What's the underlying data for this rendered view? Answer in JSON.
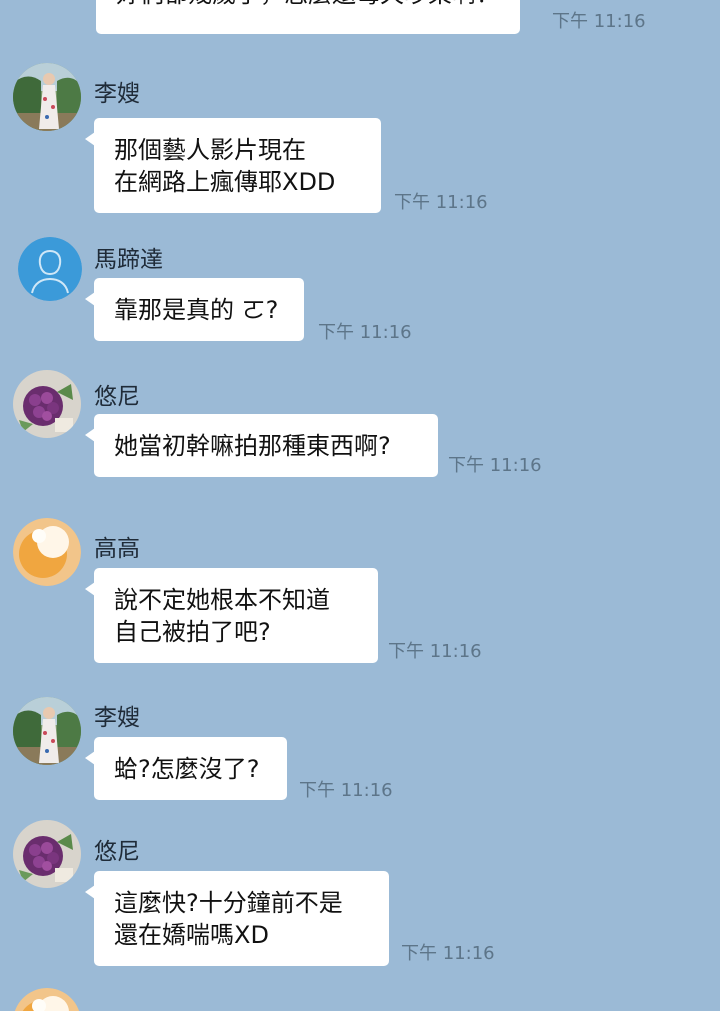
{
  "messages": [
    {
      "sender": "",
      "lines": [
        "妳們都幾歲了，怎麼還每天吵架啊？"
      ],
      "time": "下午 11:16",
      "avatar": "none",
      "partial": true
    },
    {
      "sender": "李嫂",
      "lines": [
        "那個藝人影片現在",
        "在網路上瘋傳耶XDD"
      ],
      "time": "下午 11:16",
      "avatar": "woman-photo-avatar"
    },
    {
      "sender": "馬蹄達",
      "lines": [
        "靠那是真的 ㄛ?"
      ],
      "time": "下午 11:16",
      "avatar": "default-person-avatar"
    },
    {
      "sender": "悠尼",
      "lines": [
        "她當初幹嘛拍那種東西啊?"
      ],
      "time": "下午 11:16",
      "avatar": "flower-bouquet-avatar"
    },
    {
      "sender": "高高",
      "lines": [
        "說不定她根本不知道",
        "自己被拍了吧?"
      ],
      "time": "下午 11:16",
      "avatar": "egg-avatar"
    },
    {
      "sender": "李嫂",
      "lines": [
        "蛤?怎麼沒了?"
      ],
      "time": "下午 11:16",
      "avatar": "woman-photo-avatar"
    },
    {
      "sender": "悠尼",
      "lines": [
        "這麼快?十分鐘前不是",
        "還在嬌喘嗎XD"
      ],
      "time": "下午 11:16",
      "avatar": "flower-bouquet-avatar"
    }
  ],
  "colors": {
    "background": "#9bbad6",
    "bubble": "#ffffff",
    "time_text": "#5d7589",
    "default_avatar": "#3b9ad9"
  }
}
